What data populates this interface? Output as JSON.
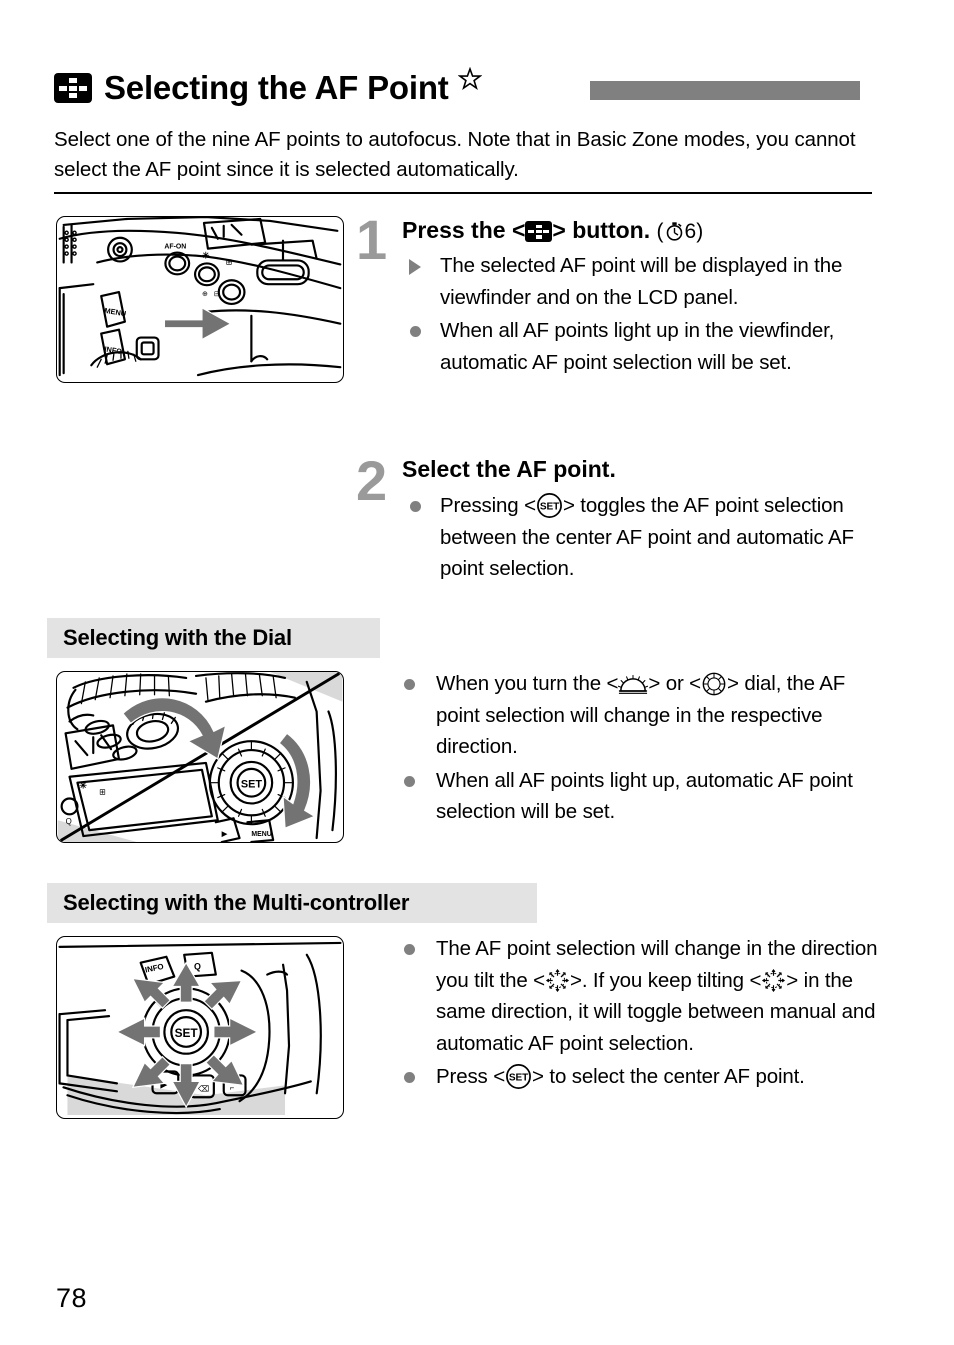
{
  "page": {
    "number": "78",
    "title": "Selecting the AF Point",
    "title_icon": "af-point-selection-icon",
    "star_marker": "star-icon",
    "intro": "Select one of the nine AF points to autofocus. Note that in Basic Zone modes, you cannot select the AF point since it is selected automatically.",
    "header_bar_color": "#808080",
    "section_header_bg": "#e3e3e3",
    "bullet_color": "#808080",
    "step_number_color": "#9a9a9a"
  },
  "steps": [
    {
      "number": "1",
      "heading_before": "Press the <",
      "heading_icon": "af-point-selection-icon",
      "heading_after": "> button.",
      "timer_note_open": "(",
      "timer_note_value": "6",
      "timer_note_close": ")",
      "figure_name": "camera-rear-af-point-button-illustration",
      "bullets": [
        {
          "marker": "triangle",
          "text": "The selected AF point will be displayed in the viewfinder and on the LCD panel."
        },
        {
          "marker": "dot",
          "text": "When all AF points light up in the viewfinder, automatic AF point selection will be set."
        }
      ]
    },
    {
      "number": "2",
      "heading": "Select the AF point.",
      "bullets": [
        {
          "marker": "dot",
          "text_before": "Pressing <",
          "icon": "set-button-icon",
          "text_after": "> toggles the AF point selection between the center AF point and automatic AF point selection."
        }
      ]
    }
  ],
  "sections": [
    {
      "id": "dial",
      "heading": "Selecting with the Dial",
      "figure_name": "camera-main-dial-and-quick-control-dial-illustration",
      "bullets": [
        {
          "marker": "dot",
          "text_before": "When you turn the <",
          "icon1": "main-dial-icon",
          "text_mid": "> or <",
          "icon2": "quick-control-dial-icon",
          "text_after": "> dial, the AF point selection will change in the respective direction."
        },
        {
          "marker": "dot",
          "text": "When all AF points light up, automatic AF point selection will be set."
        }
      ]
    },
    {
      "id": "multi",
      "heading": "Selecting with the Multi-controller",
      "figure_name": "camera-multi-controller-illustration",
      "bullets": [
        {
          "marker": "dot",
          "text_before": "The AF point selection will change in the direction you tilt the <",
          "icon1": "multi-controller-icon",
          "text_mid": ">. If you keep tilting <",
          "icon2": "multi-controller-icon",
          "text_after": "> in the same direction, it will toggle between manual and automatic AF point selection."
        },
        {
          "marker": "dot",
          "text_before": "Press <",
          "icon": "set-button-icon",
          "text_after": "> to select the center AF point."
        }
      ]
    }
  ]
}
